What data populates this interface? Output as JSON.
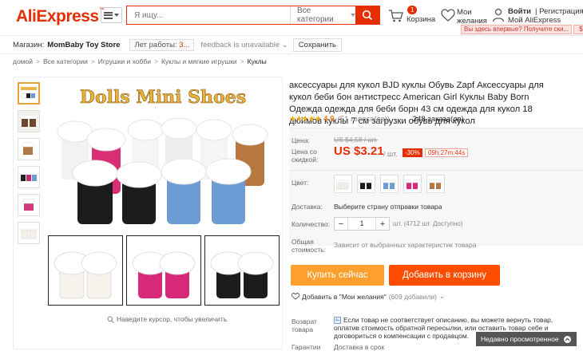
{
  "header": {
    "logo": "AliExpress",
    "search_placeholder": "Я ищу...",
    "category": "Все категории",
    "cart_count": "1",
    "cart_label": "Корзина",
    "wishlist_label": "Мои желания",
    "login": "Войти",
    "register": "Регистрация",
    "my_aliexpress": "Мой AliExpress",
    "promo_text": "Вы здесь впервые? Получите ски...",
    "promo_currency": "$"
  },
  "store": {
    "label": "Магазин:",
    "name": "MomBaby Toy Store",
    "years_label": "Лет работы:",
    "years_value": "3",
    "feedback": "feedback is unavailable",
    "save": "Сохранить"
  },
  "breadcrumb": [
    "домой",
    "Все категории",
    "Игрушки и хобби",
    "Куклы и мягкие игрушки",
    "Куклы"
  ],
  "gallery": {
    "banner": "Dolls Mini Shoes",
    "hint": "Наведите курсор, чтобы увеличить"
  },
  "product": {
    "title": "аксессуары для кукол BJD куклы Обувь Zapf Аксессуары для кукол беби бон антистресс American Girl Куклы Baby Born Одежда одежда для беби борн 43 см одежда для кукол 18 дюймов куклы 7 см загрузки обувь для кукол",
    "rating": "4.9",
    "votes": "(51 голоса(ов))",
    "orders": "248 заказа(ов)",
    "price_label": "Цена:",
    "old_price": "US $4,58 / шт.",
    "discount_label": "Цена со скидкой:",
    "new_price": "US $3.21",
    "per_unit": "/ шт.",
    "discount": "-30%",
    "timer": "09h:27m:44s",
    "color_label": "Цвет:",
    "shipping_label": "Доставка:",
    "shipping_value": "Выберите страну отправки товара",
    "qty_label": "Количество:",
    "qty_value": "1",
    "qty_available": "шт. (4712 шт. Доступно)",
    "total_label": "Общая стоимость:",
    "total_value": "Зависит от выбранных характеристик товара",
    "buy_now": "Купить сейчас",
    "add_to_cart": "Добавить в корзину",
    "wish_add": "Добавить в \"Мои желания\"",
    "wish_count": "(609 добавили)",
    "return_label": "Возврат товара",
    "return_text": "Если товар не соответствует описанию, вы можете вернуть товар, оплатив стоимость обратной пересылки, или оставить товар себе и договориться о компенсации с продавцом.",
    "guarantee_label": "Гарантии",
    "guarantee_text": "Доставка в срок"
  },
  "recently_viewed": "Недавно просмотренное",
  "colors": {
    "brand": "#e62e04",
    "buy_now": "#ffa02e",
    "add_to_cart": "#ff4d00",
    "star": "#f0a81a"
  }
}
